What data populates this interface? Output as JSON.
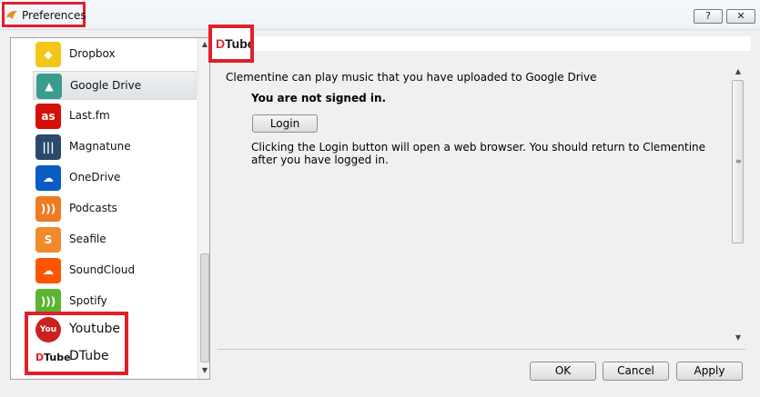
{
  "window": {
    "title": "Preferences",
    "help_label": "?",
    "close_label": "✕"
  },
  "sidebar": {
    "items": [
      {
        "label": "Dropbox",
        "icon": "dropbox-icon",
        "color": "#f5c518",
        "glyph": "◆"
      },
      {
        "label": "Google Drive",
        "icon": "google-drive-icon",
        "color": "#3c9c8c",
        "glyph": "▲",
        "selected": true
      },
      {
        "label": "Last.fm",
        "icon": "lastfm-icon",
        "color": "#d51007",
        "glyph": "as"
      },
      {
        "label": "Magnatune",
        "icon": "magnatune-icon",
        "color": "#2a4a6a",
        "glyph": "|||"
      },
      {
        "label": "OneDrive",
        "icon": "onedrive-icon",
        "color": "#0a5cc2",
        "glyph": "☁"
      },
      {
        "label": "Podcasts",
        "icon": "podcasts-icon",
        "color": "#ee7a21",
        "glyph": ")))"
      },
      {
        "label": "Seafile",
        "icon": "seafile-icon",
        "color": "#f08a2c",
        "glyph": "S"
      },
      {
        "label": "SoundCloud",
        "icon": "soundcloud-icon",
        "color": "#ff5500",
        "glyph": "☁"
      },
      {
        "label": "Spotify",
        "icon": "spotify-icon",
        "color": "#5cb531",
        "glyph": ")))"
      },
      {
        "label": "Youtube",
        "icon": "youtube-icon",
        "color": "#cc1f1f",
        "glyph": "You"
      },
      {
        "label": "DTube",
        "icon": "dtube-icon",
        "color": "#ffffff",
        "glyph": "DTube"
      }
    ]
  },
  "page": {
    "header_logo": "DTube",
    "info": "Clementine can play music that you have uploaded to Google Drive",
    "status": "You are not signed in.",
    "login_label": "Login",
    "hint": "Clicking the Login button will open a web browser.  You should return to Clementine after you have logged in."
  },
  "buttons": {
    "ok": "OK",
    "cancel": "Cancel",
    "apply": "Apply"
  },
  "colors": {
    "highlight": "#e0202a"
  }
}
